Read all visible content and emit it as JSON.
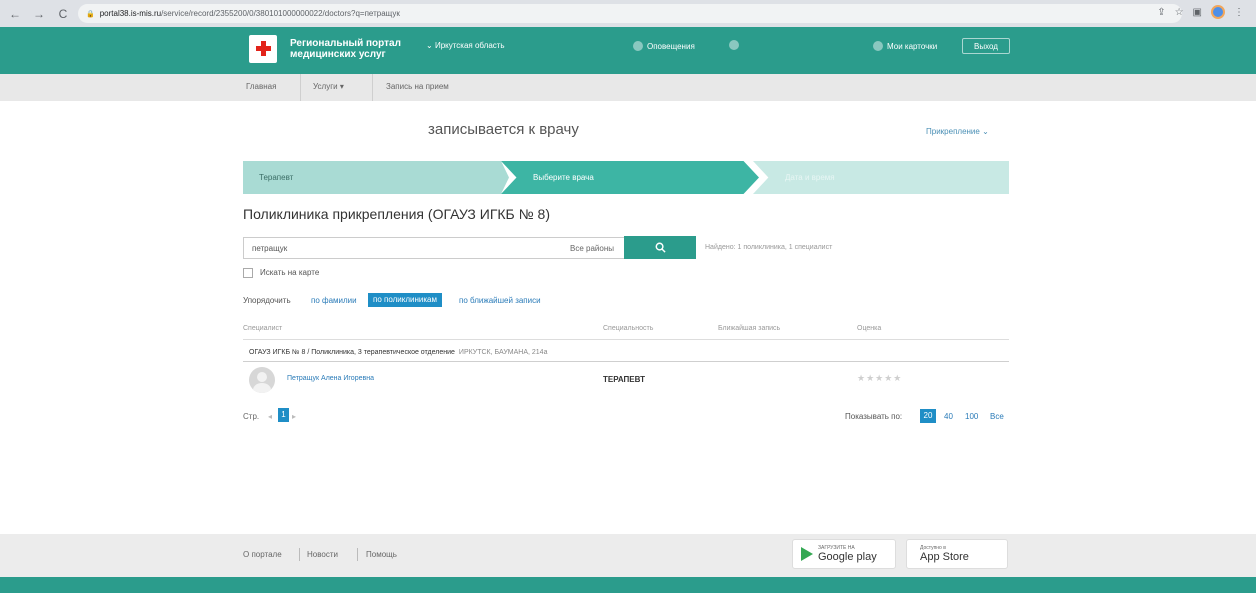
{
  "browser": {
    "url_host": "portal38.is-mis.ru",
    "url_path": "/service/record/2355200/0/380101000000022/doctors?q=петращук",
    "back": "←",
    "forward": "→",
    "reload": "C"
  },
  "header": {
    "portal_title": "Региональный портал медицинских услуг",
    "region": "Иркутская область",
    "notifications": "Оповещения",
    "cards": "Мои карточки",
    "logout": "Выход"
  },
  "breadcrumbs": {
    "home": "Главная",
    "services": "Услуги",
    "current": "Запись на прием"
  },
  "page": {
    "patient_line": "записывается к врачу",
    "attachment": "Прикрепление"
  },
  "steps": {
    "step1": "Терапевт",
    "step2": "Выберите врача",
    "step3": "Дата и время"
  },
  "clinic_heading": "Поликлиника прикрепления (ОГАУЗ ИГКБ № 8)",
  "search": {
    "value": "петращук",
    "districts": "Все районы",
    "found": "Найдено: 1 поликлиника, 1 специалист",
    "map_label": "Искать на карте"
  },
  "sort": {
    "label": "Упорядочить",
    "by_name": "по фамилии",
    "by_clinic": "по поликлиникам",
    "by_nearest": "по ближайшей записи"
  },
  "table": {
    "columns": [
      "Специалист",
      "Специальность",
      "Ближайшая запись",
      "Оценка"
    ],
    "clinic_name": "ОГАУЗ ИГКБ № 8 / Поликлиника, 3 терапевтическое отделение",
    "clinic_address": "ИРКУТСК, БАУМАНА, 214а",
    "doctor_name": "Петращук Алена Игоревна",
    "doctor_spec": "ТЕРАПЕВТ",
    "stars": "★★★★★"
  },
  "pager": {
    "label": "Стр.",
    "current": "1",
    "prev": "◂",
    "next": "▸",
    "show_label": "Показывать по:",
    "options": [
      "20",
      "40",
      "100",
      "Все"
    ]
  },
  "footer": {
    "about": "О портале",
    "news": "Новости",
    "help": "Помощь",
    "gplay_small": "ЗАГРУЗИТЕ НА",
    "gplay_big": "Google play",
    "appstore_small": "Доступно в",
    "appstore_big": "App Store"
  },
  "colors": {
    "brand": "#2b9c8c",
    "link": "#2a7bb8",
    "active": "#1f8ec6"
  }
}
